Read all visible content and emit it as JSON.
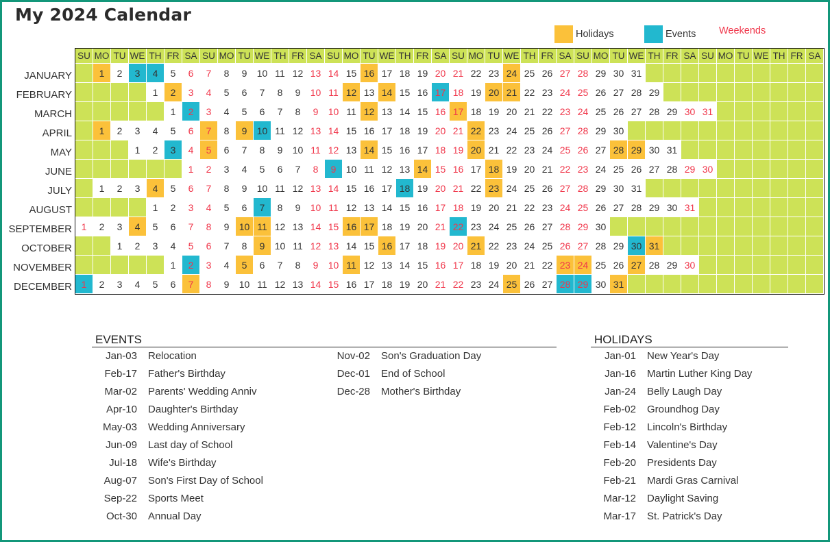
{
  "title": "My 2024 Calendar",
  "year": 2024,
  "colors": {
    "holiday": "#fbc13a",
    "event": "#22b8cf",
    "weekend_text": "#f0364a",
    "blank": "#cde257",
    "frame": "#13977a"
  },
  "legend": {
    "holidays_label": "Holidays",
    "events_label": "Events",
    "weekends_label": "Weekends"
  },
  "weekday_headers": [
    "SU",
    "MO",
    "TU",
    "WE",
    "TH",
    "FR",
    "SA"
  ],
  "months": [
    {
      "name": "JANUARY",
      "days": 31,
      "start": 1
    },
    {
      "name": "FEBRUARY",
      "days": 29,
      "start": 4
    },
    {
      "name": "MARCH",
      "days": 31,
      "start": 5
    },
    {
      "name": "APRIL",
      "days": 30,
      "start": 1
    },
    {
      "name": "MAY",
      "days": 31,
      "start": 3
    },
    {
      "name": "JUNE",
      "days": 30,
      "start": 6
    },
    {
      "name": "JULY",
      "days": 31,
      "start": 1
    },
    {
      "name": "AUGUST",
      "days": 31,
      "start": 4
    },
    {
      "name": "SEPTEMBER",
      "days": 30,
      "start": 0
    },
    {
      "name": "OCTOBER",
      "days": 31,
      "start": 2
    },
    {
      "name": "NOVEMBER",
      "days": 30,
      "start": 5
    },
    {
      "name": "DECEMBER",
      "days": 31,
      "start": 0
    }
  ],
  "highlights": {
    "holidays": {
      "1": [
        1,
        16,
        24
      ],
      "2": [
        2,
        12,
        14,
        20,
        21
      ],
      "3": [
        12,
        17
      ],
      "4": [
        1,
        7,
        9,
        22
      ],
      "5": [
        5,
        14,
        20,
        28,
        29
      ],
      "6": [
        14,
        18
      ],
      "7": [
        4,
        23
      ],
      "8": [],
      "9": [
        4,
        10,
        11,
        16,
        17
      ],
      "10": [
        9,
        16,
        21,
        31
      ],
      "11": [
        5,
        11,
        23,
        24,
        27
      ],
      "12": [
        7,
        25,
        31
      ]
    },
    "events": {
      "1": [
        3,
        4
      ],
      "2": [
        17
      ],
      "3": [
        2
      ],
      "4": [
        10
      ],
      "5": [
        3
      ],
      "6": [
        9
      ],
      "7": [
        18
      ],
      "8": [
        7
      ],
      "9": [
        22
      ],
      "10": [
        30
      ],
      "11": [
        2
      ],
      "12": [
        1,
        28,
        29
      ]
    }
  },
  "events_list": {
    "heading": "EVENTS",
    "columns": [
      [
        {
          "date": "Jan-03",
          "name": "Relocation"
        },
        {
          "date": "Feb-17",
          "name": "Father's Birthday"
        },
        {
          "date": "Mar-02",
          "name": "Parents' Wedding Anniv"
        },
        {
          "date": "Apr-10",
          "name": "Daughter's Birthday"
        },
        {
          "date": "May-03",
          "name": "Wedding Anniversary"
        },
        {
          "date": "Jun-09",
          "name": "Last day of School"
        },
        {
          "date": "Jul-18",
          "name": "Wife's Birthday"
        },
        {
          "date": "Aug-07",
          "name": "Son's First Day of School"
        },
        {
          "date": "Sep-22",
          "name": "Sports Meet"
        },
        {
          "date": "Oct-30",
          "name": "Annual Day"
        }
      ],
      [
        {
          "date": "Nov-02",
          "name": "Son's Graduation Day"
        },
        {
          "date": "Dec-01",
          "name": "End of School"
        },
        {
          "date": "Dec-28",
          "name": "Mother's Birthday"
        }
      ]
    ]
  },
  "holidays_list": {
    "heading": "HOLIDAYS",
    "items": [
      {
        "date": "Jan-01",
        "name": "New Year's Day"
      },
      {
        "date": "Jan-16",
        "name": "Martin Luther King Day"
      },
      {
        "date": "Jan-24",
        "name": "Belly Laugh Day"
      },
      {
        "date": "Feb-02",
        "name": "Groundhog Day"
      },
      {
        "date": "Feb-12",
        "name": "Lincoln's Birthday"
      },
      {
        "date": "Feb-14",
        "name": "Valentine's Day"
      },
      {
        "date": "Feb-20",
        "name": "Presidents Day"
      },
      {
        "date": "Feb-21",
        "name": "Mardi Gras Carnival"
      },
      {
        "date": "Mar-12",
        "name": "Daylight Saving"
      },
      {
        "date": "Mar-17",
        "name": "St. Patrick's Day"
      }
    ]
  }
}
